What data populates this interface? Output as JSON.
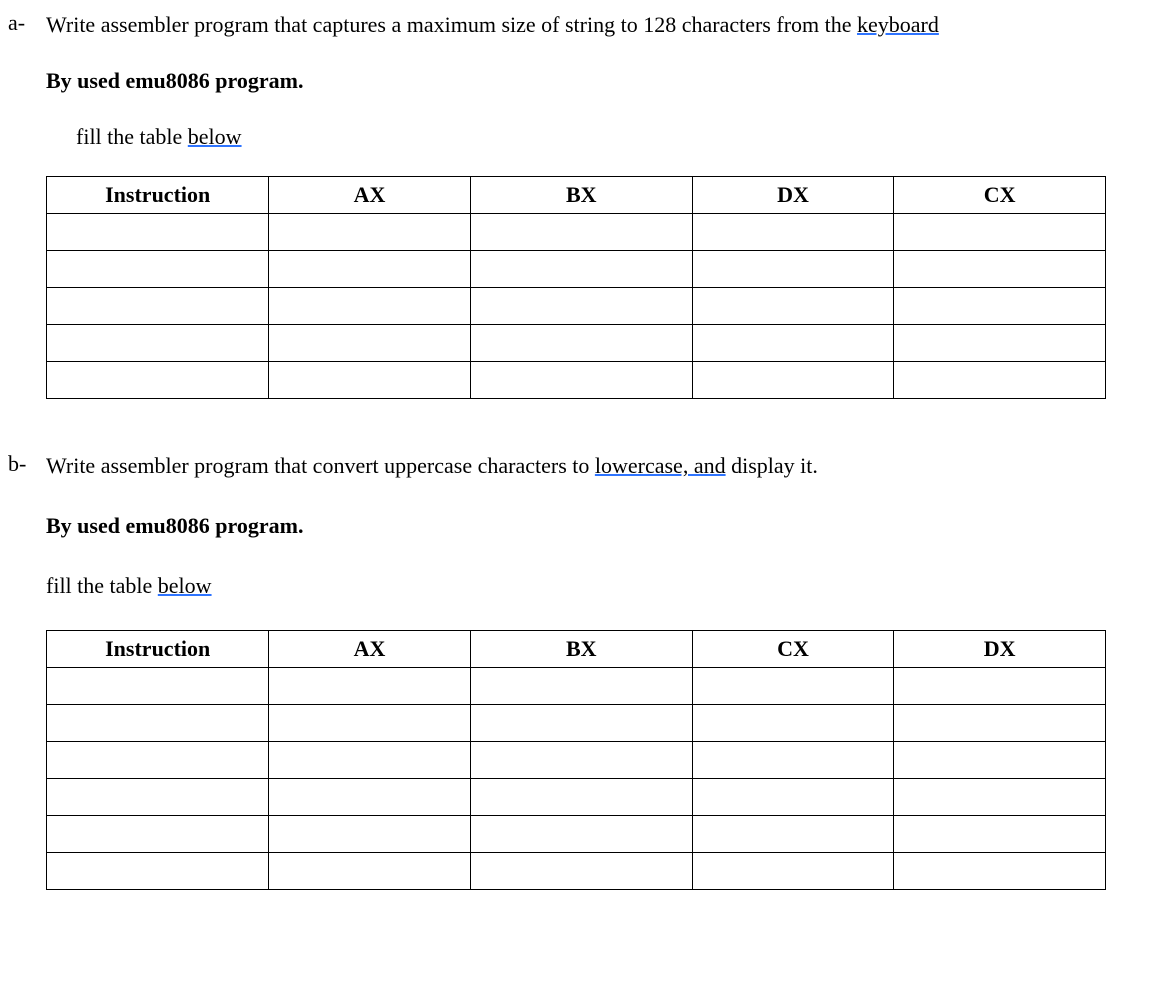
{
  "a": {
    "marker": "a-",
    "line1_pre": "Write assembler program that captures a maximum size of string to 128 characters from the ",
    "line1_link": "keyboard",
    "line2": "By used emu8086 program.",
    "line3_pre": "fill the table ",
    "line3_link": "below",
    "table": {
      "headers": [
        "Instruction",
        "AX",
        "BX",
        "DX",
        "CX"
      ],
      "rows": 5
    }
  },
  "b": {
    "marker": "b-",
    "line1_pre": "Write assembler program that convert uppercase characters to ",
    "line1_link": "lowercase, and",
    "line1_post": " display it.",
    "line2": "By used emu8086 program.",
    "line3_pre": "fill the table ",
    "line3_link": "below",
    "table": {
      "headers": [
        "Instruction",
        "AX",
        "BX",
        "CX",
        "DX"
      ],
      "rows": 6
    }
  }
}
